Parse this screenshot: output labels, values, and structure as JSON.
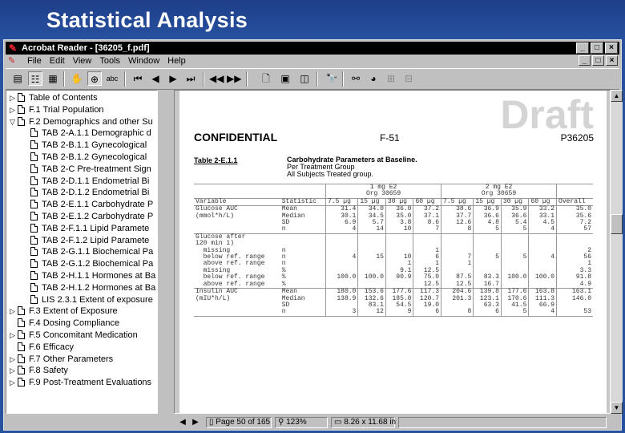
{
  "slide_title": "Statistical Analysis",
  "window": {
    "title": "Acrobat Reader - [36205_f.pdf]",
    "minimize_label": "_",
    "maximize_label": "□",
    "close_label": "×"
  },
  "menu": [
    "File",
    "Edit",
    "View",
    "Tools",
    "Window",
    "Help"
  ],
  "toolbar_icons": [
    "show-document-icon",
    "bookmarks-and-page-icon",
    "thumbnails-and-page-icon",
    "hand-tool-icon",
    "zoom-tool-icon",
    "text-select-icon",
    "first-page-icon",
    "previous-page-icon",
    "next-page-icon",
    "last-page-icon",
    "go-back-icon",
    "go-forward-icon",
    "actual-size-icon",
    "fit-page-icon",
    "fit-width-icon",
    "find-icon",
    "web-link-icon",
    "weblink-icon",
    "page-tools-icon",
    "page-tools-2-icon"
  ],
  "bookmarks": [
    {
      "label": "Table of Contents",
      "level": 0,
      "expand": "▷"
    },
    {
      "label": "F.1 Trial Population",
      "level": 0,
      "expand": "▷"
    },
    {
      "label": "F.2 Demographics and other Su",
      "level": 0,
      "expand": "▽"
    },
    {
      "label": "TAB 2-A.1.1 Demographic d",
      "level": 1,
      "expand": ""
    },
    {
      "label": "TAB 2-B.1.1 Gynecological",
      "level": 1,
      "expand": ""
    },
    {
      "label": "TAB 2-B.1.2 Gynecological",
      "level": 1,
      "expand": ""
    },
    {
      "label": "TAB 2-C Pre-treatment Sign",
      "level": 1,
      "expand": ""
    },
    {
      "label": "TAB 2-D.1.1 Endometrial Bi",
      "level": 1,
      "expand": ""
    },
    {
      "label": "TAB 2-D.1.2 Endometrial Bi",
      "level": 1,
      "expand": ""
    },
    {
      "label": "TAB 2-E.1.1 Carbohydrate P",
      "level": 1,
      "expand": ""
    },
    {
      "label": "TAB 2-E.1.2 Carbohydrate P",
      "level": 1,
      "expand": ""
    },
    {
      "label": "TAB 2-F.1.1 Lipid Paramete",
      "level": 1,
      "expand": ""
    },
    {
      "label": "TAB 2-F.1.2 Lipid Paramete",
      "level": 1,
      "expand": ""
    },
    {
      "label": "TAB 2-G.1.1 Biochemical Pa",
      "level": 1,
      "expand": ""
    },
    {
      "label": "TAB 2-G.1.2 Biochemical Pa",
      "level": 1,
      "expand": ""
    },
    {
      "label": "TAB 2-H.1.1 Hormones at Ba",
      "level": 1,
      "expand": ""
    },
    {
      "label": "TAB 2-H.1.2 Hormones at Ba",
      "level": 1,
      "expand": ""
    },
    {
      "label": "LIS 2.3.1 Extent of exposure",
      "level": 1,
      "expand": ""
    },
    {
      "label": "F.3 Extent of Exposure",
      "level": 0,
      "expand": "▷"
    },
    {
      "label": "F.4 Dosing Compliance",
      "level": 0,
      "expand": ""
    },
    {
      "label": "F.5 Concomitant Medication",
      "level": 0,
      "expand": "▷"
    },
    {
      "label": "F.6 Efficacy",
      "level": 0,
      "expand": ""
    },
    {
      "label": "F.7 Other Parameters",
      "level": 0,
      "expand": "▷"
    },
    {
      "label": "F.8 Safety",
      "level": 0,
      "expand": "▷"
    },
    {
      "label": "F.9 Post-Treatment Evaluations",
      "level": 0,
      "expand": "▷"
    }
  ],
  "document": {
    "watermark": "Draft",
    "confidential": "CONFIDENTIAL",
    "page_code": "F-51",
    "protocol": "P36205",
    "table_id": "Table 2-E.1.1",
    "caption_title": "Carbohydrate Parameters at Baseline.",
    "caption_line2": "Per Treatment Group",
    "caption_line3": "All  Subjects  Treated group.",
    "table": {
      "groups": [
        "1 mg E2",
        "2 mg E2"
      ],
      "subgroups": [
        "Org 30659",
        "Org 30659"
      ],
      "header": [
        "Variable",
        "Statistic",
        "7.5 µg",
        "15 µg",
        "30 µg",
        "60 µg",
        "7.5 µg",
        "15 µg",
        "30 µg",
        "60 µg",
        "Overall"
      ],
      "sections": [
        {
          "rows": [
            [
              "Glucose AUC",
              "Mean",
              "31.4",
              "34.0",
              "36.0",
              "37.2",
              "38.6",
              "36.9",
              "35.9",
              "33.2",
              "35.0"
            ],
            [
              "(mmol*h/L)",
              "Median",
              "30.1",
              "34.5",
              "35.0",
              "37.1",
              "37.7",
              "36.6",
              "36.6",
              "33.1",
              "35.6"
            ],
            [
              "",
              "SD",
              "6.9",
              "5.7",
              "3.8",
              "8.6",
              "12.6",
              "4.8",
              "5.4",
              "4.5",
              "7.2"
            ],
            [
              "",
              "n",
              "4",
              "14",
              "10",
              "7",
              "8",
              "5",
              "5",
              "4",
              "57"
            ]
          ]
        },
        {
          "rows": [
            [
              "Glucose after",
              "",
              "",
              "",
              "",
              "",
              "",
              "",
              "",
              "",
              ""
            ],
            [
              "120 min 1)",
              "",
              "",
              "",
              "",
              "",
              "",
              "",
              "",
              "",
              ""
            ],
            [
              "  missing",
              "n",
              "",
              "",
              "",
              "1",
              "",
              "",
              "",
              "",
              "2"
            ],
            [
              "  below ref. range",
              "n",
              "4",
              "15",
              "10",
              "6",
              "7",
              "5",
              "5",
              "4",
              "56"
            ],
            [
              "  above ref. range",
              "n",
              "",
              "",
              "1",
              "1",
              "1",
              "",
              "",
              "",
              "1"
            ],
            [
              "  missing",
              "%",
              "",
              "",
              "9.1",
              "12.5",
              "",
              "",
              "",
              "",
              "3.3"
            ],
            [
              "  below ref. range",
              "%",
              "100.0",
              "100.0",
              "90.9",
              "75.0",
              "87.5",
              "83.3",
              "100.0",
              "100.0",
              "91.8"
            ],
            [
              "  above ref. range",
              "%",
              "",
              "",
              "",
              "12.5",
              "12.5",
              "16.7",
              "",
              "",
              "4.9"
            ]
          ]
        },
        {
          "rows": [
            [
              "Insulin AUC",
              "Mean",
              "180.0",
              "153.6",
              "177.6",
              "117.3",
              "204.6",
              "139.8",
              "177.6",
              "163.8",
              "163.1"
            ],
            [
              "(mIU*h/L)",
              "Median",
              "138.9",
              "132.6",
              "185.0",
              "120.7",
              "201.3",
              "123.1",
              "170.6",
              "111.3",
              "146.0"
            ],
            [
              "",
              "SD",
              "",
              "83.1",
              "54.5",
              "19.0",
              "",
              "63.3",
              "41.5",
              "66.9",
              ""
            ],
            [
              "",
              "n",
              "3",
              "12",
              "9",
              "6",
              "8",
              "6",
              "5",
              "4",
              "53"
            ]
          ]
        }
      ]
    }
  },
  "status": {
    "page_text": "Page 50 of 165",
    "zoom_text": "123%",
    "size_text": "8.26 x 11.68 in"
  }
}
